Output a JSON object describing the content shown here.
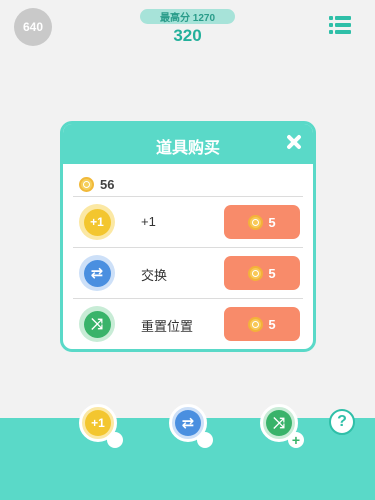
{
  "header": {
    "coins_display": "640",
    "best_score": "最高分 1270",
    "current_score": "320"
  },
  "dialog": {
    "title": "道具购买",
    "balance": "56",
    "items": [
      {
        "label": "+1",
        "icon": "plus-one-icon",
        "price": "5",
        "color": "#f3c62f"
      },
      {
        "label": "交换",
        "icon": "swap-icon",
        "price": "5",
        "color": "#4a8fe0"
      },
      {
        "label": "重置位置",
        "icon": "shuffle-icon",
        "price": "5",
        "color": "#39b36a"
      }
    ]
  },
  "tools": [
    {
      "name": "plus-one-tool",
      "icon_text": "+1",
      "color": "#f3c62f"
    },
    {
      "name": "swap-tool",
      "icon_text": "⇄",
      "color": "#4a8fe0"
    },
    {
      "name": "shuffle-tool",
      "icon_text": "⤨",
      "color": "#39b36a"
    }
  ],
  "help_label": "?",
  "colors": {
    "teal": "#5ad9c8",
    "buy_button": "#f88b6a"
  }
}
